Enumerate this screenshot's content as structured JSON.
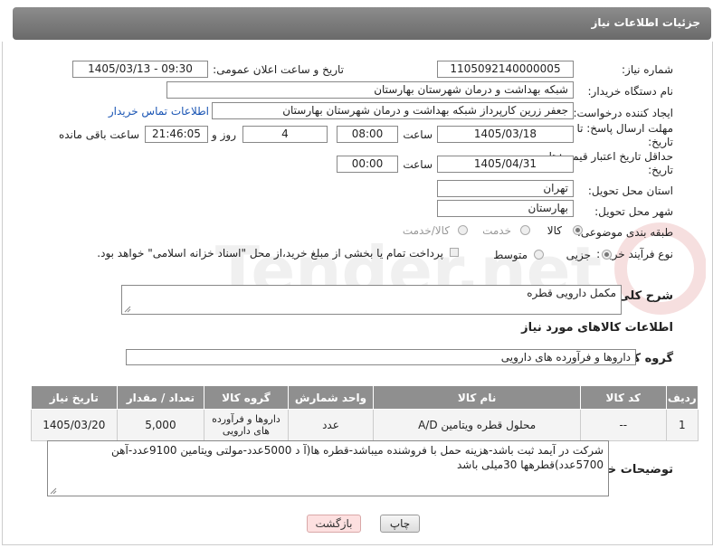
{
  "header": {
    "title": "جزئیات اطلاعات نیاز"
  },
  "fields": {
    "need_number_label": "شماره نیاز:",
    "need_number": "1105092140000005",
    "announce_label": "تاریخ و ساعت اعلان عمومی:",
    "announce_value": "1405/03/13 - 09:30",
    "buyer_org_label": "نام دستگاه خریدار:",
    "buyer_org": "شبکه بهداشت و درمان شهرستان بهارستان",
    "creator_label": "ایجاد کننده درخواست:",
    "creator": "جعفر زرین کارپرداز شبکه بهداشت و درمان شهرستان بهارستان",
    "contact_link": "اطلاعات تماس خریدار",
    "deadline_label": "مهلت ارسال پاسخ: تا تاریخ:",
    "deadline_date": "1405/03/18",
    "time_label": "ساعت",
    "deadline_time": "08:00",
    "days_value": "4",
    "days_label": "روز و",
    "remaining_time": "21:46:05",
    "remaining_label": "ساعت باقی مانده",
    "min_validity_label": "حداقل تاریخ اعتبار قیمت: تا تاریخ:",
    "validity_date": "1405/04/31",
    "validity_time": "00:00",
    "province_label": "استان محل تحویل:",
    "province": "تهران",
    "city_label": "شهر محل تحویل:",
    "city": "بهارستان",
    "category_label": "طبقه بندی موضوعی:",
    "cat_goods": "کالا",
    "cat_service": "خدمت",
    "cat_goods_service": "کالا/خدمت",
    "process_label": "نوع فرآیند خرید :",
    "proc_partial": "جزیی",
    "proc_medium": "متوسط",
    "payment_note": "پرداخت تمام یا بخشی از مبلغ خرید،از محل \"اسناد خزانه اسلامی\" خواهد بود.",
    "description_label": "شرح کلی نیاز:",
    "description": "مکمل دارویی قطره",
    "goods_info_title": "اطلاعات کالاهای مورد نیاز",
    "goods_group_label": "گروه کالا:",
    "goods_group": "داروها و فرآورده های دارویی",
    "buyer_notes_label": "توضیحات خریدار:",
    "buyer_notes": "شرکت در آیمد ثبت باشد-هزینه حمل با فروشنده میباشد-قطره ها(آ د 5000عدد-مولتی ویتامین 9100عدد-آهن 5700عدد)قطرهها 30میلی باشد"
  },
  "table": {
    "headers": [
      "ردیف",
      "کد کالا",
      "نام کالا",
      "واحد شمارش",
      "گروه کالا",
      "تعداد / مقدار",
      "تاریخ نیاز"
    ],
    "rows": [
      [
        "1",
        "--",
        "محلول قطره ویتامین A/D",
        "عدد",
        "داروها و فرآورده های دارویی",
        "5,000",
        "1405/03/20"
      ]
    ]
  },
  "buttons": {
    "print": "چاپ",
    "back": "بازگشت"
  },
  "watermark": {
    "text": "AriaTender.net"
  },
  "colors": {
    "header_bg": "#7a7a7a",
    "table_header_bg": "#8f8f8f",
    "link": "#1a55b4",
    "back_button_bg": "#fde0e0"
  }
}
